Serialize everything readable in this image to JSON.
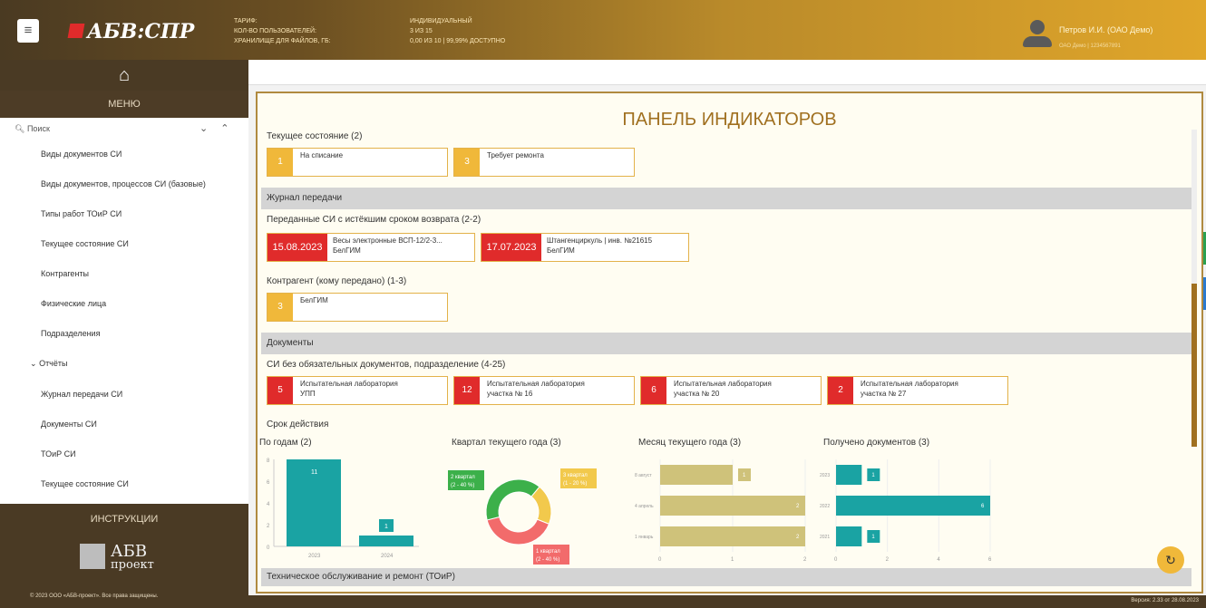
{
  "header": {
    "logo_text": "АБВ:СПР",
    "tariff_label": "ТАРИФ:",
    "tariff_value": "ИНДИВИДУАЛЬНЫЙ",
    "users_label": "КОЛ-ВО ПОЛЬЗОВАТЕЛЕЙ:",
    "users_value": "3 ИЗ 15",
    "storage_label": "ХРАНИЛИЩЕ ДЛЯ ФАЙЛОВ, ГБ:",
    "storage_value": "0,00 ИЗ 10 | 99,99% ДОСТУПНО",
    "user_name": "Петров И.И. (ОАО Демо)",
    "user_org": "ОАО Демо | 1234567891"
  },
  "sidebar": {
    "menu_title": "МЕНЮ",
    "search": "Поиск",
    "items": [
      "Виды документов СИ",
      "Виды документов, процессов СИ (базовые)",
      "Типы работ ТОиР СИ",
      "Текущее состояние СИ",
      "Контрагенты",
      "Физические лица",
      "Подразделения"
    ],
    "group": "Отчёты",
    "reports": [
      "Журнал передачи СИ",
      "Документы СИ",
      "ТОиР СИ",
      "Текущее состояние СИ"
    ],
    "instructions": "ИНСТРУКЦИИ",
    "brand_line1": "АБВ",
    "brand_line2": "проект",
    "copyright": "© 2023 ООО «АБВ-проект». Все права защищены."
  },
  "footer": {
    "version": "Версия: 2.33 от 28.08.2023"
  },
  "panel": {
    "title": "ПАНЕЛЬ ИНДИКАТОРОВ",
    "current_state": "Текущее состояние (2)",
    "state_cards": [
      {
        "num": "1",
        "label": "На списание"
      },
      {
        "num": "3",
        "label": "Требует ремонта"
      }
    ],
    "journal": "Журнал передачи",
    "overdue_label": "Переданные СИ с истёкшим сроком возврата (2-2)",
    "overdue_cards": [
      {
        "date": "15.08.2023",
        "line1": "Весы электронные ВСП-12/2-3...",
        "line2": "БелГИМ"
      },
      {
        "date": "17.07.2023",
        "line1": "Штангенциркуль | инв. №21615",
        "line2": "БелГИМ"
      }
    ],
    "counterparty_label": "Контрагент (кому передано) (1-3)",
    "counterparty_card": {
      "num": "3",
      "label": "БелГИМ"
    },
    "documents": "Документы",
    "nodocs_label": "СИ без обязательных документов, подразделение (4-25)",
    "nodocs_cards": [
      {
        "num": "5",
        "line1": "Испытательная лаборатория",
        "line2": "УПП"
      },
      {
        "num": "12",
        "line1": "Испытательная лаборатория",
        "line2": "участка № 16"
      },
      {
        "num": "6",
        "line1": "Испытательная лаборатория",
        "line2": "участка № 20"
      },
      {
        "num": "2",
        "line1": "Испытательная лаборатория",
        "line2": "участка № 27"
      }
    ],
    "validity": "Срок действия",
    "toir": "Техническое обслуживание и ремонт (ТОиР)"
  },
  "chart_data": [
    {
      "type": "bar",
      "title": "По годам (2)",
      "categories": [
        "2023",
        "2024"
      ],
      "values": [
        11,
        1
      ],
      "ylim": [
        0,
        8
      ],
      "yticks": [
        "0",
        "2",
        "4",
        "6",
        "8"
      ],
      "color": "#1aa3a3"
    },
    {
      "type": "pie",
      "title": "Квартал текущего года (3)",
      "slices": [
        {
          "label": "1 квартал",
          "sub": "(2 - 40 %)",
          "value": 2,
          "color": "#f26b6b"
        },
        {
          "label": "2 квартал",
          "sub": "(2 - 40 %)",
          "value": 2,
          "color": "#3cb04a"
        },
        {
          "label": "3 квартал",
          "sub": "(1 - 20 %)",
          "value": 1,
          "color": "#f2c94c"
        }
      ]
    },
    {
      "type": "bar",
      "orientation": "horizontal",
      "title": "Месяц текущего года (3)",
      "categories": [
        "8 август",
        "4 апрель",
        "1 январь"
      ],
      "values": [
        1,
        2,
        2
      ],
      "xlim": [
        0,
        2
      ],
      "xticks": [
        "0",
        "1",
        "2"
      ],
      "color": "#cfc27a"
    },
    {
      "type": "bar",
      "orientation": "horizontal",
      "title": "Получено документов (3)",
      "categories": [
        "2023",
        "2022",
        "2021"
      ],
      "values": [
        1,
        6,
        1
      ],
      "xlim": [
        0,
        6
      ],
      "xticks": [
        "0",
        "2",
        "4",
        "6"
      ],
      "color": "#1aa3a3"
    }
  ]
}
